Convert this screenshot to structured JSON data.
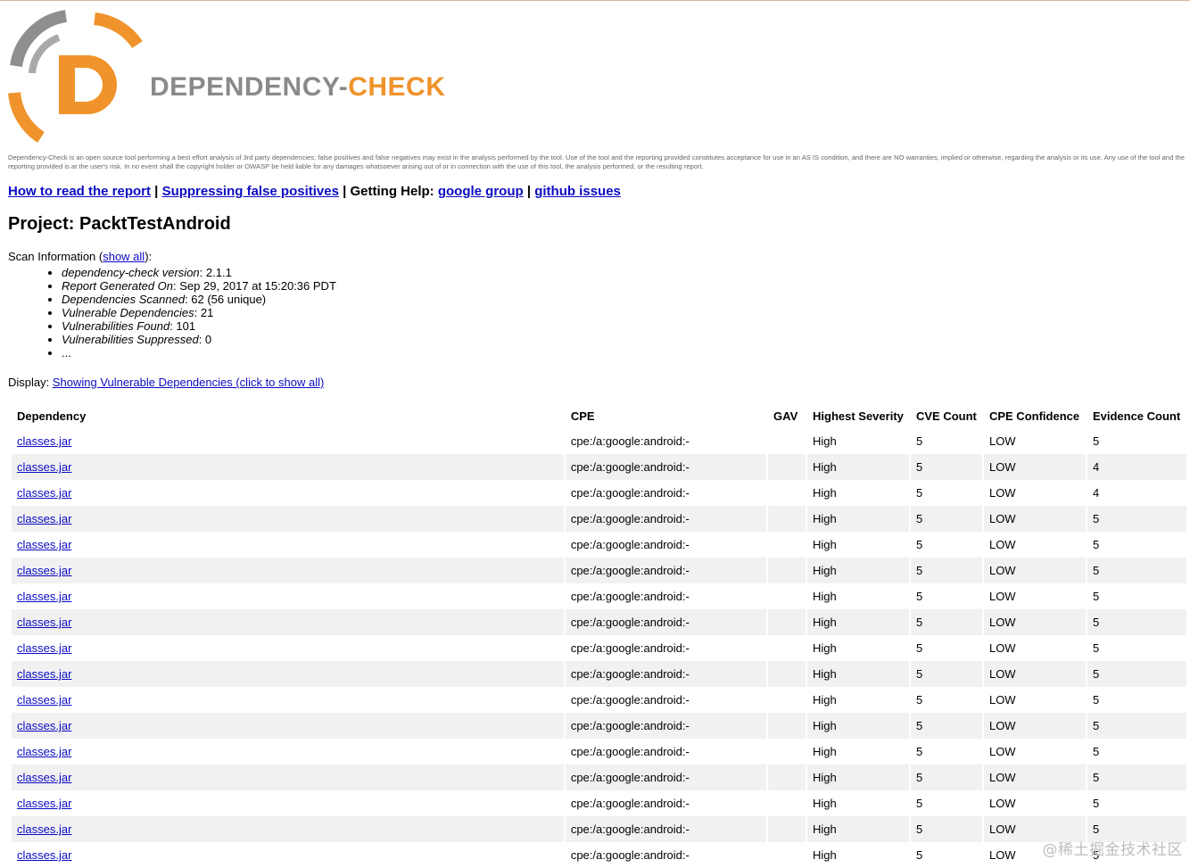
{
  "header": {
    "brand_part1": "DEPENDENCY-",
    "brand_part2": "CHECK",
    "disclaimer": "Dependency-Check is an open source tool performing a best effort analysis of 3rd party dependencies; false positives and false negatives may exist in the analysis performed by the tool. Use of the tool and the reporting provided constitutes acceptance for use in an AS IS condition, and there are NO warranties, implied or otherwise, regarding the analysis or its use. Any use of the tool and the reporting provided is at the user's risk. In no event shall the copyright holder or OWASP be held liable for any damages whatsoever arising out of or in connection with the use of this tool, the analysis performed, or the resulting report."
  },
  "helpbar": {
    "link1": "How to read the report",
    "sep1": " | ",
    "link2": "Suppressing false positives",
    "sep2": " | Getting Help: ",
    "link3": "google group",
    "sep3": " | ",
    "link4": "github issues"
  },
  "project_title": "Project: PacktTestAndroid",
  "scan_info": {
    "label": "Scan Information (",
    "show_all": "show all",
    "label_end": "):",
    "items": [
      {
        "key": "dependency-check version",
        "value": ": 2.1.1"
      },
      {
        "key": "Report Generated On",
        "value": ": Sep 29, 2017 at 15:20:36 PDT"
      },
      {
        "key": "Dependencies Scanned",
        "value": ": 62 (56 unique)"
      },
      {
        "key": "Vulnerable Dependencies",
        "value": ": 21"
      },
      {
        "key": "Vulnerabilities Found",
        "value": ": 101"
      },
      {
        "key": "Vulnerabilities Suppressed",
        "value": ": 0"
      },
      {
        "key": "",
        "value": "..."
      }
    ]
  },
  "display": {
    "label": "Display: ",
    "link": "Showing Vulnerable Dependencies (click to show all)"
  },
  "table": {
    "headers": [
      "Dependency",
      "CPE",
      "GAV",
      "Highest Severity",
      "CVE Count",
      "CPE Confidence",
      "Evidence Count"
    ],
    "rows": [
      [
        "classes.jar",
        "cpe:/a:google:android:-",
        "",
        "High",
        "5",
        "LOW",
        "5"
      ],
      [
        "classes.jar",
        "cpe:/a:google:android:-",
        "",
        "High",
        "5",
        "LOW",
        "4"
      ],
      [
        "classes.jar",
        "cpe:/a:google:android:-",
        "",
        "High",
        "5",
        "LOW",
        "4"
      ],
      [
        "classes.jar",
        "cpe:/a:google:android:-",
        "",
        "High",
        "5",
        "LOW",
        "5"
      ],
      [
        "classes.jar",
        "cpe:/a:google:android:-",
        "",
        "High",
        "5",
        "LOW",
        "5"
      ],
      [
        "classes.jar",
        "cpe:/a:google:android:-",
        "",
        "High",
        "5",
        "LOW",
        "5"
      ],
      [
        "classes.jar",
        "cpe:/a:google:android:-",
        "",
        "High",
        "5",
        "LOW",
        "5"
      ],
      [
        "classes.jar",
        "cpe:/a:google:android:-",
        "",
        "High",
        "5",
        "LOW",
        "5"
      ],
      [
        "classes.jar",
        "cpe:/a:google:android:-",
        "",
        "High",
        "5",
        "LOW",
        "5"
      ],
      [
        "classes.jar",
        "cpe:/a:google:android:-",
        "",
        "High",
        "5",
        "LOW",
        "5"
      ],
      [
        "classes.jar",
        "cpe:/a:google:android:-",
        "",
        "High",
        "5",
        "LOW",
        "5"
      ],
      [
        "classes.jar",
        "cpe:/a:google:android:-",
        "",
        "High",
        "5",
        "LOW",
        "5"
      ],
      [
        "classes.jar",
        "cpe:/a:google:android:-",
        "",
        "High",
        "5",
        "LOW",
        "5"
      ],
      [
        "classes.jar",
        "cpe:/a:google:android:-",
        "",
        "High",
        "5",
        "LOW",
        "5"
      ],
      [
        "classes.jar",
        "cpe:/a:google:android:-",
        "",
        "High",
        "5",
        "LOW",
        "5"
      ],
      [
        "classes.jar",
        "cpe:/a:google:android:-",
        "",
        "High",
        "5",
        "LOW",
        "5"
      ],
      [
        "classes.jar",
        "cpe:/a:google:android:-",
        "",
        "High",
        "5",
        "LOW",
        "5"
      ]
    ]
  },
  "watermark": "@稀土掘金技术社区",
  "colors": {
    "brand_gray": "#8a8a8a",
    "brand_orange": "#f0932b",
    "link_blue": "#0b0bc4",
    "row_alt": "#f1f1f1"
  }
}
